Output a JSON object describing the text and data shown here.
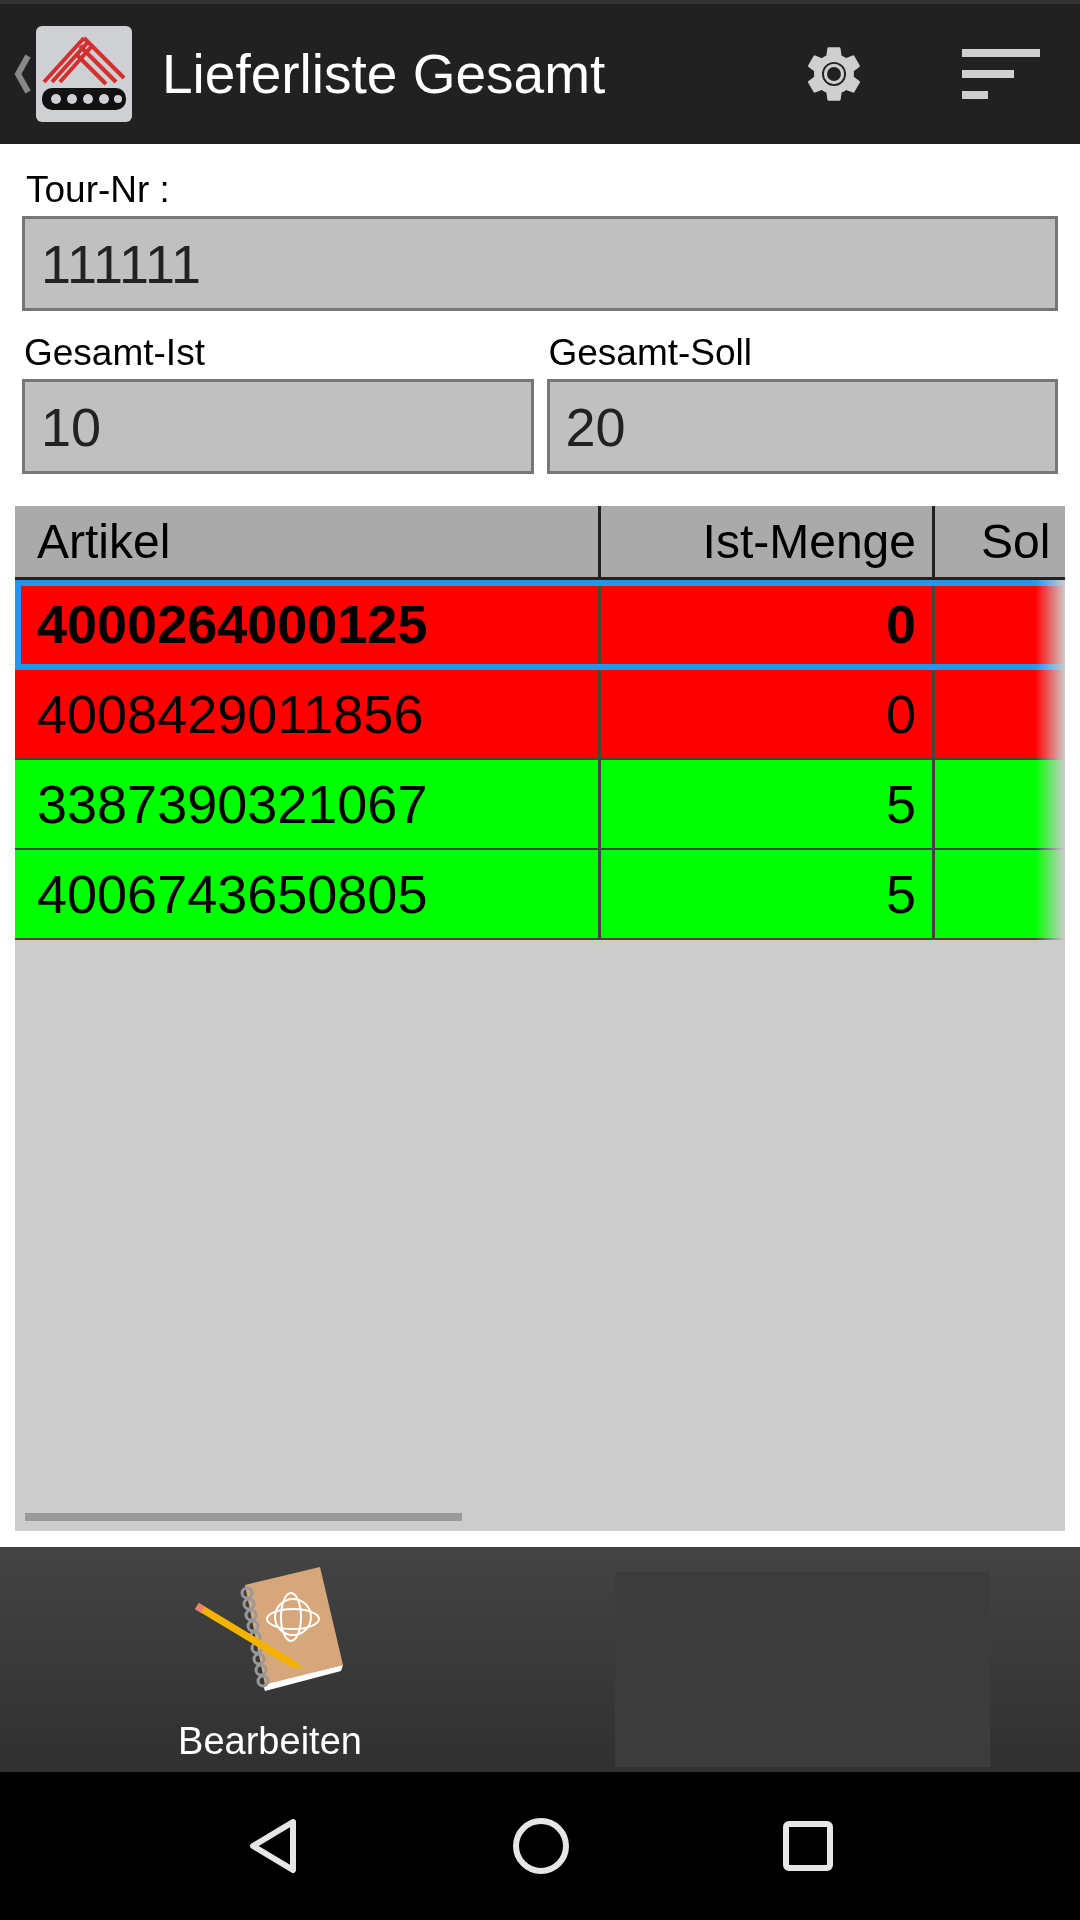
{
  "header": {
    "title": "Lieferliste Gesamt"
  },
  "tour": {
    "label": "Tour-Nr :",
    "value": "111111"
  },
  "totals": [
    {
      "label": "Gesamt-Ist",
      "value": "10"
    },
    {
      "label": "Gesamt-Soll",
      "value": "20"
    }
  ],
  "table": {
    "columns": [
      "Artikel",
      "Ist-Menge",
      "Sol"
    ],
    "rows": [
      {
        "artikel": "4000264000125",
        "ist_menge": "0",
        "color": "#ff0000",
        "selected": true
      },
      {
        "artikel": "4008429011856",
        "ist_menge": "0",
        "color": "#ff0000",
        "selected": false
      },
      {
        "artikel": "3387390321067",
        "ist_menge": "5",
        "color": "#00ff00",
        "selected": false
      },
      {
        "artikel": "4006743650805",
        "ist_menge": "5",
        "color": "#00ff00",
        "selected": false
      }
    ]
  },
  "bottom_bar": {
    "buttons": [
      {
        "label": "Bearbeiten"
      }
    ]
  }
}
